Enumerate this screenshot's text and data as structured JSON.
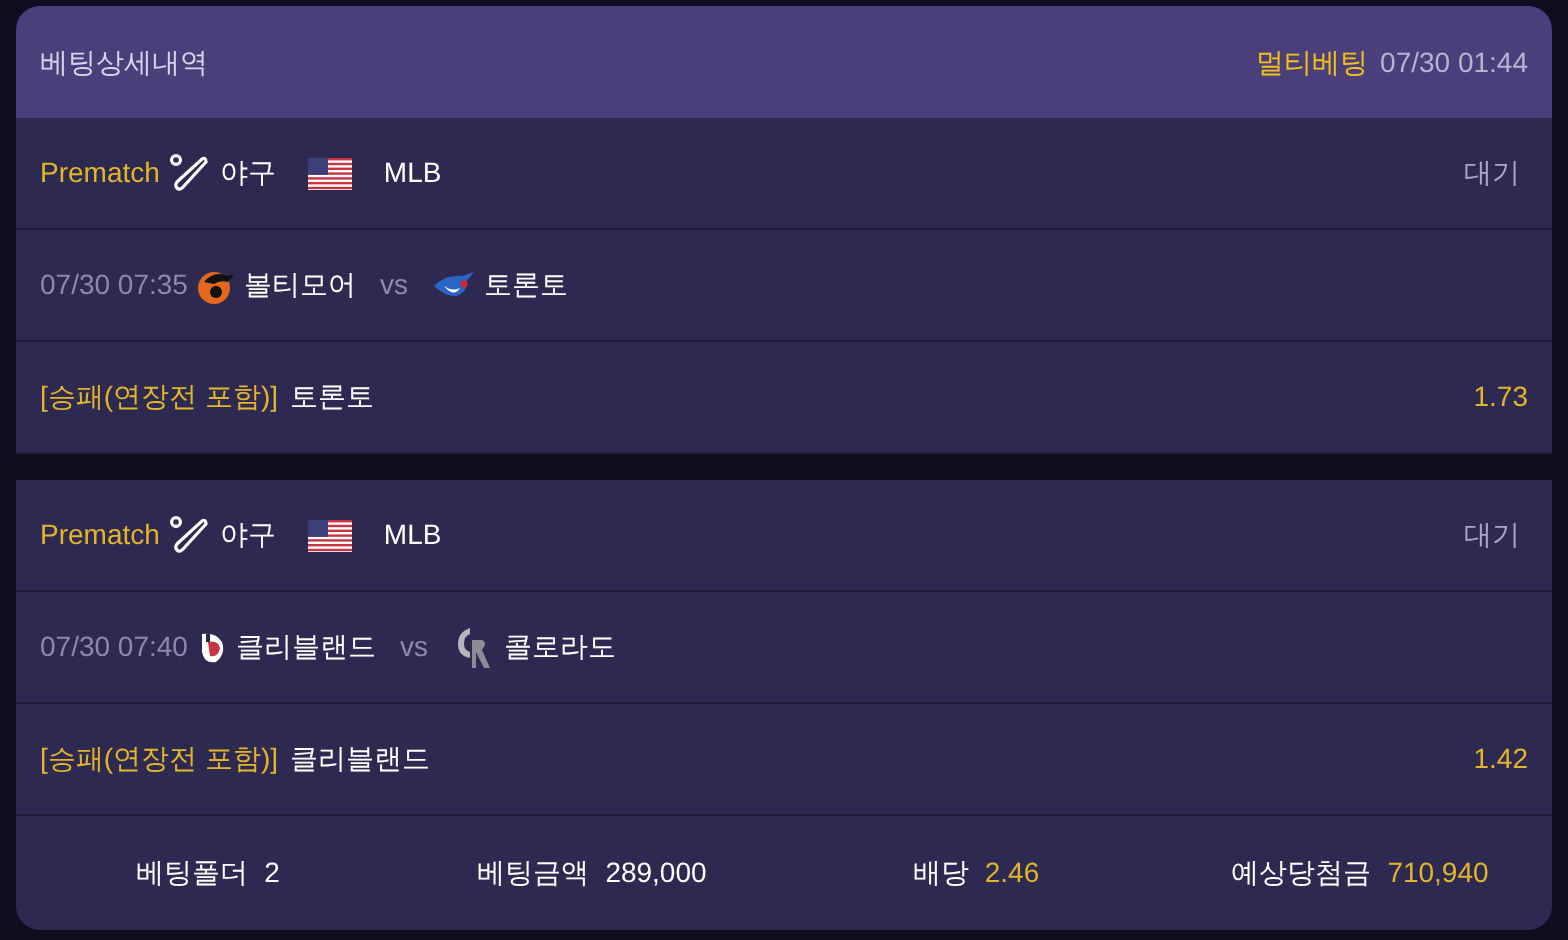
{
  "header": {
    "title": "베팅상세내역",
    "bet_type": "멀티베팅",
    "time": "07/30 01:44"
  },
  "bets": [
    {
      "stage": "Prematch",
      "sport": "야구",
      "league": "MLB",
      "status": "대기",
      "time": "07/30 07:35",
      "home": {
        "name": "볼티모어",
        "kind": "orangebird"
      },
      "vs": "vs",
      "away": {
        "name": "토론토",
        "kind": "bluebird"
      },
      "market": "[승패(연장전 포함)]",
      "pick": "토론토",
      "odds": "1.73"
    },
    {
      "stage": "Prematch",
      "sport": "야구",
      "league": "MLB",
      "status": "대기",
      "time": "07/30 07:40",
      "home": {
        "name": "클리블랜드",
        "kind": "redcrest"
      },
      "vs": "vs",
      "away": {
        "name": "콜로라도",
        "kind": "graycrest"
      },
      "market": "[승패(연장전 포함)]",
      "pick": "클리블랜드",
      "odds": "1.42"
    }
  ],
  "summary": [
    {
      "label": "베팅폴더",
      "value": "2",
      "highlight": false
    },
    {
      "label": "베팅금액",
      "value": "289,000",
      "highlight": false
    },
    {
      "label": "배당",
      "value": "2.46",
      "highlight": true
    },
    {
      "label": "예상당첨금",
      "value": "710,940",
      "highlight": true
    }
  ]
}
